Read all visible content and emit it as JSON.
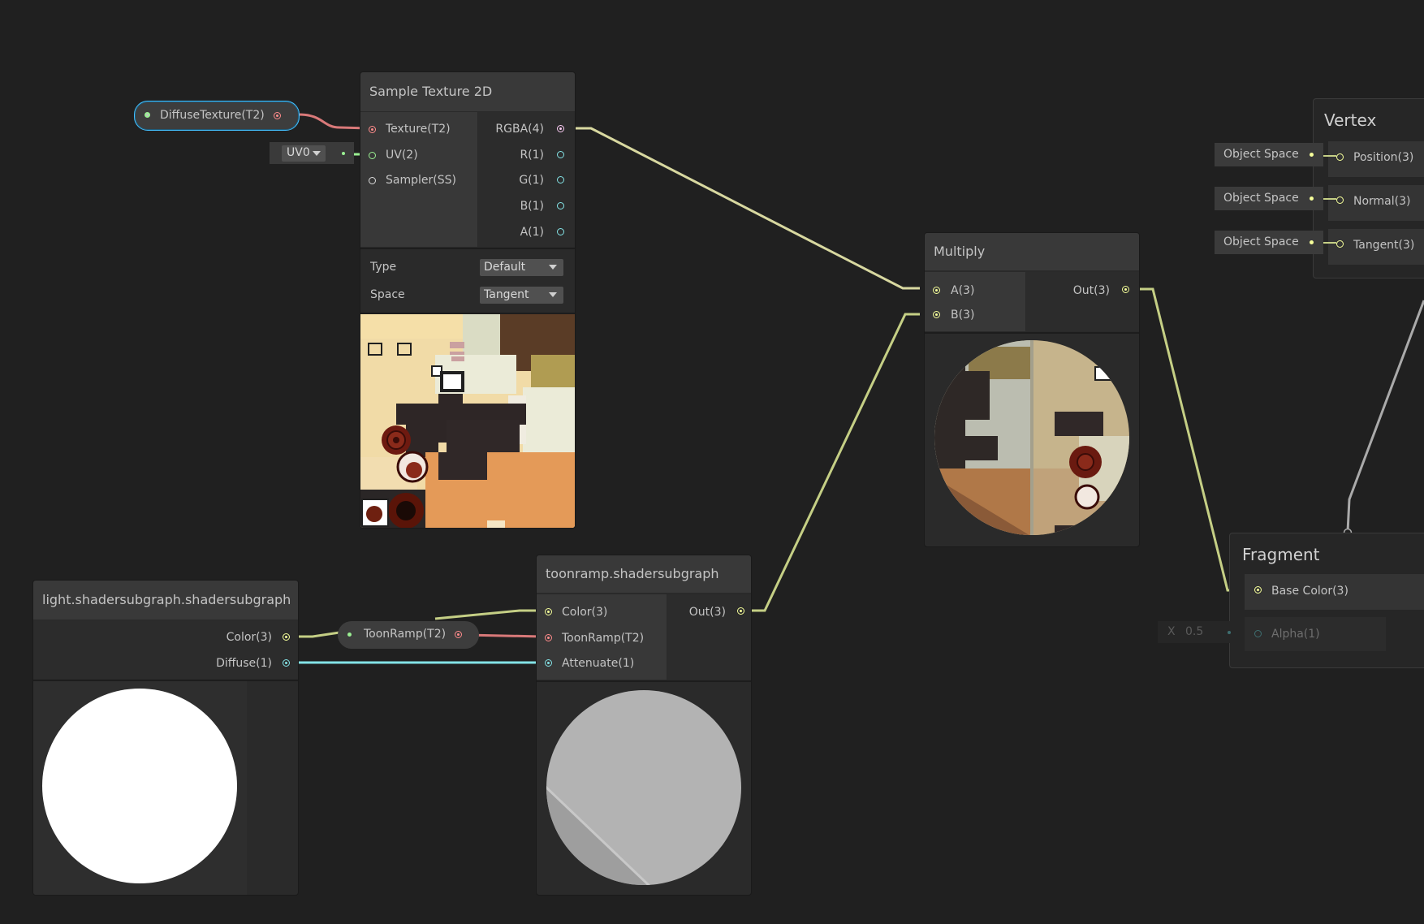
{
  "properties": {
    "diffuse_texture": "DiffuseTexture(T2)",
    "toon_ramp": "ToonRamp(T2)"
  },
  "uv_field": {
    "value": "UV0"
  },
  "sample_texture": {
    "title": "Sample Texture 2D",
    "inputs": [
      "Texture(T2)",
      "UV(2)",
      "Sampler(SS)"
    ],
    "outputs": [
      "RGBA(4)",
      "R(1)",
      "G(1)",
      "B(1)",
      "A(1)"
    ],
    "type_label": "Type",
    "type_value": "Default",
    "space_label": "Space",
    "space_value": "Tangent"
  },
  "multiply": {
    "title": "Multiply",
    "inputs": [
      "A(3)",
      "B(3)"
    ],
    "outputs": [
      "Out(3)"
    ]
  },
  "vertex": {
    "title": "Vertex",
    "ports": [
      "Position(3)",
      "Normal(3)",
      "Tangent(3)"
    ],
    "space_fields": [
      "Object Space",
      "Object Space",
      "Object Space"
    ]
  },
  "fragment": {
    "title": "Fragment",
    "ports": [
      "Base Color(3)",
      "Alpha(1)"
    ],
    "alpha_field": {
      "axis": "X",
      "value": "0.5"
    }
  },
  "light_node": {
    "title": "light.shadersubgraph.shadersubgraph",
    "outputs": [
      "Color(3)",
      "Diffuse(1)"
    ]
  },
  "toonramp_node": {
    "title": "toonramp.shadersubgraph",
    "inputs": [
      "Color(3)",
      "ToonRamp(T2)",
      "Attenuate(1)"
    ],
    "outputs": [
      "Out(3)"
    ]
  },
  "colors": {
    "background": "#202020",
    "vector3_port": "#f6ff9a",
    "vector2_port": "#9aef92",
    "vector1_port": "#84e4e7",
    "texture_port": "#ff8b8b",
    "vector4_port": "#fbcbf4",
    "sampler_port": "#dddddd",
    "selection_outline": "#44c0ff"
  }
}
